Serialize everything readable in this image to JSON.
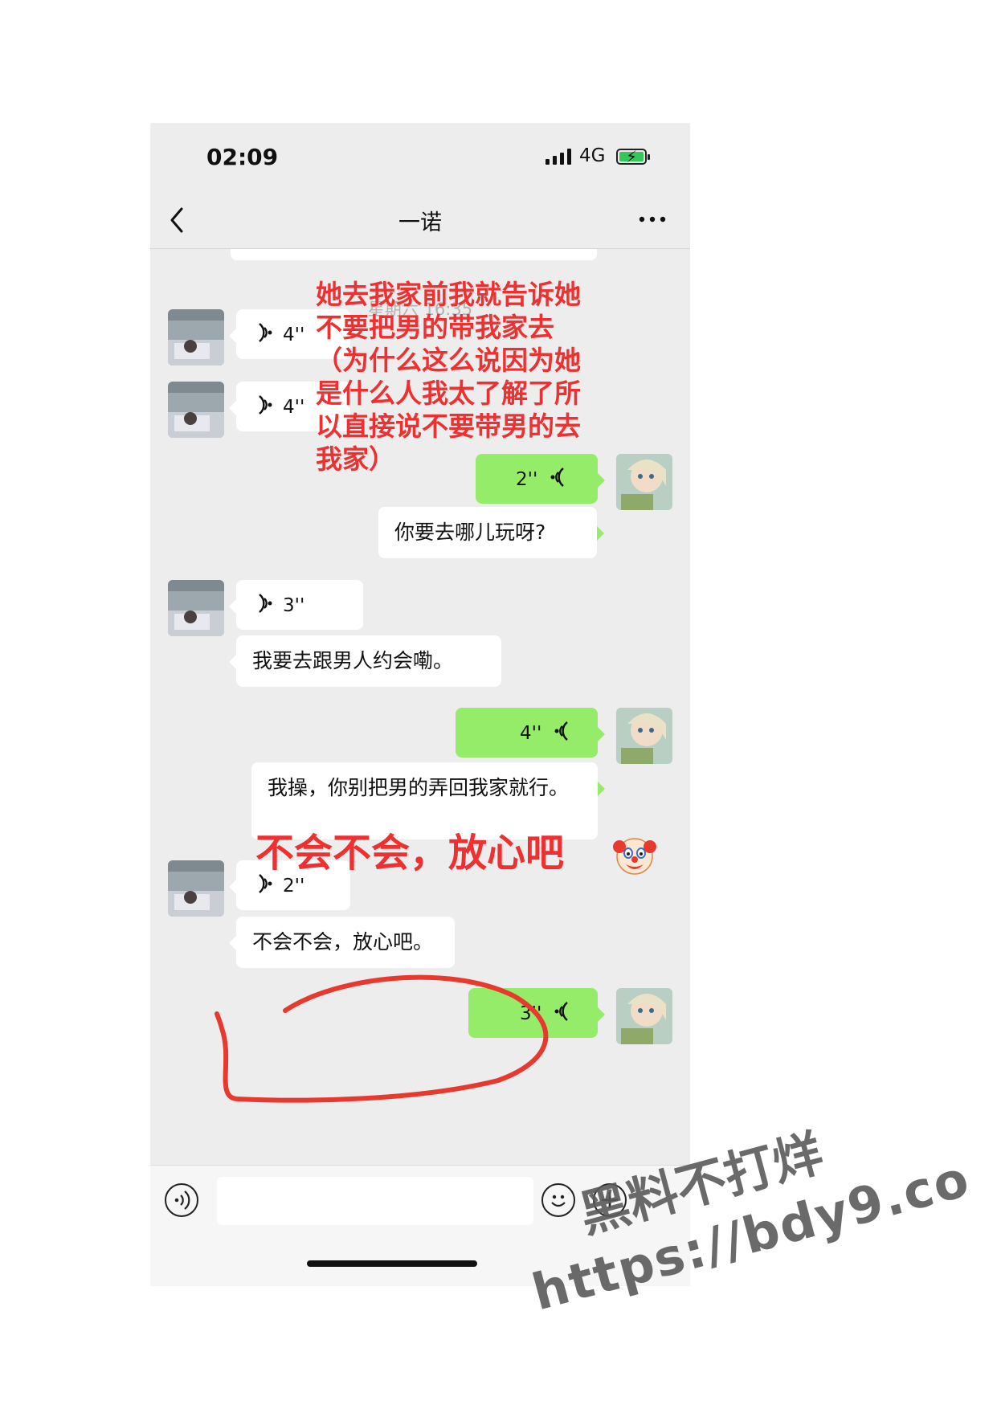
{
  "status_bar": {
    "time": "02:09",
    "network": "4G"
  },
  "nav": {
    "back_icon": "chevron-left-icon",
    "title": "一诺",
    "more_icon": "more-icon"
  },
  "timestamp": "星期六 16:35",
  "messages": [
    {
      "side": "left",
      "type": "voice",
      "duration": "4''"
    },
    {
      "side": "left",
      "type": "voice",
      "duration": "4''"
    },
    {
      "side": "right",
      "type": "voice",
      "duration": "2''"
    },
    {
      "side": "right",
      "type": "text",
      "text": "你要去哪儿玩呀?"
    },
    {
      "side": "left",
      "type": "voice",
      "duration": "3''"
    },
    {
      "side": "left",
      "type": "text",
      "text": "我要去跟男人约会嘞。"
    },
    {
      "side": "right",
      "type": "voice",
      "duration": "4''"
    },
    {
      "side": "right",
      "type": "text",
      "text": "我操，你别把男的弄回我家就行。"
    },
    {
      "side": "left",
      "type": "voice",
      "duration": "2''"
    },
    {
      "side": "left",
      "type": "text",
      "text": "不会不会，放心吧。"
    },
    {
      "side": "right",
      "type": "voice",
      "duration": "3''"
    }
  ],
  "input_bar": {
    "voice_icon": "voice-input-icon",
    "emoji_icon": "emoji-icon",
    "plus_icon": "plus-icon"
  },
  "annotations": {
    "note_lines": [
      "她去我家前我就告诉她",
      "不要把男的带我家去",
      "（为什么这么说因为她",
      "是什么人我太了解了所",
      "以直接说不要带男的去",
      "我家）"
    ],
    "reply_note": "不会不会，放心吧",
    "reply_emoji": "clown-face-icon",
    "color": "#ee3030"
  },
  "watermark": {
    "line1": "黑料不打烊",
    "line2": "https://bdy9.co"
  },
  "colors": {
    "outgoing_bubble": "#95ec69",
    "incoming_bubble": "#ffffff",
    "chat_bg": "#ededed"
  }
}
